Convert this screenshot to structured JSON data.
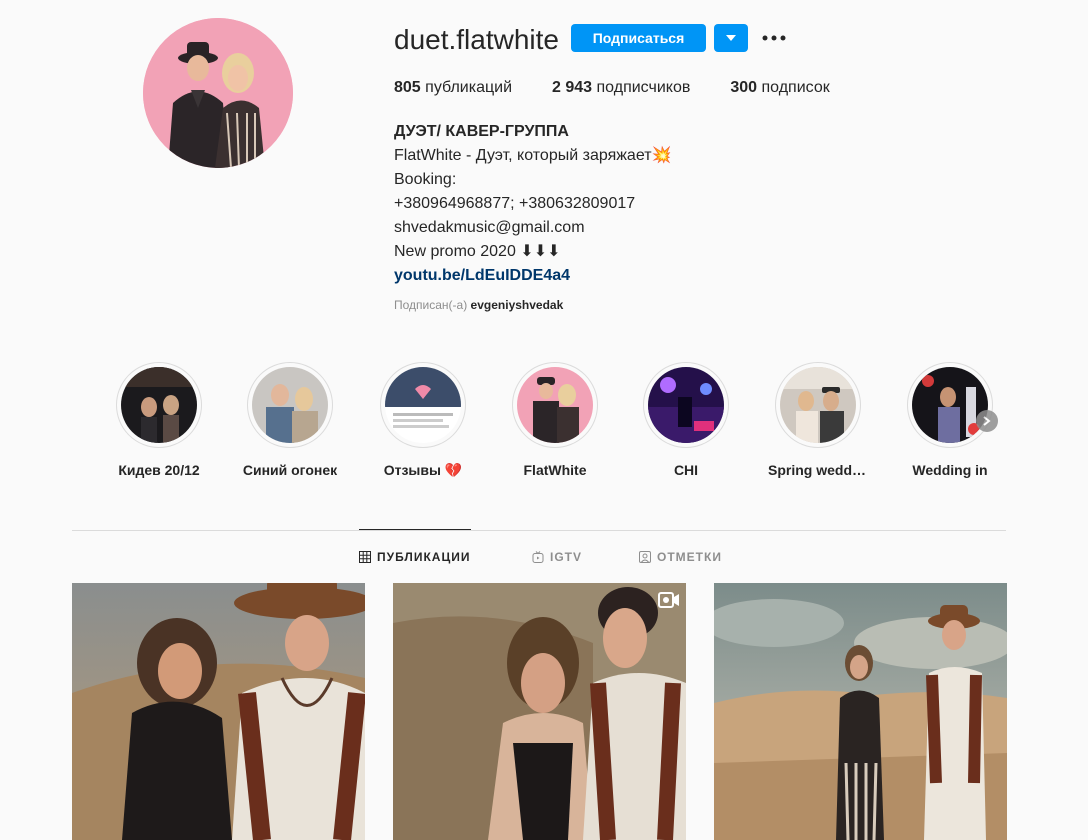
{
  "profile": {
    "username": "duet.flatwhite",
    "follow_label": "Подписаться",
    "stats": {
      "posts": "805",
      "posts_label": "публикаций",
      "followers": "2 943",
      "followers_label": "подписчиков",
      "following": "300",
      "following_label": "подписок"
    },
    "bio": {
      "title": "ДУЭТ/ КАВЕР-ГРУППА",
      "line1": "FlatWhite - Дуэт, который заряжает💥",
      "line2": "Booking:",
      "line3": "+380964968877; +380632809017",
      "line4": "shvedakmusic@gmail.com",
      "line5": "New promo 2020 ⬇⬇⬇",
      "link": "youtu.be/LdEuIDDE4a4"
    },
    "followed_by_prefix": "Подписан(-а)",
    "followed_by_user": "evgeniyshvedak"
  },
  "highlights": [
    {
      "label": "Кидев 20/12"
    },
    {
      "label": "Синий огонек"
    },
    {
      "label": "Отзывы 💔"
    },
    {
      "label": "FlatWhite"
    },
    {
      "label": "CHI"
    },
    {
      "label": "Spring wedding"
    },
    {
      "label": "Wedding in"
    }
  ],
  "tabs": {
    "posts": "ПУБЛИКАЦИИ",
    "igtv": "IGTV",
    "tagged": "ОТМЕТКИ"
  },
  "colors": {
    "accent": "#0095f6",
    "link": "#00376b",
    "text": "#262626",
    "muted": "#8e8e8e",
    "border": "#dbdbdb",
    "background": "#fafafa"
  }
}
